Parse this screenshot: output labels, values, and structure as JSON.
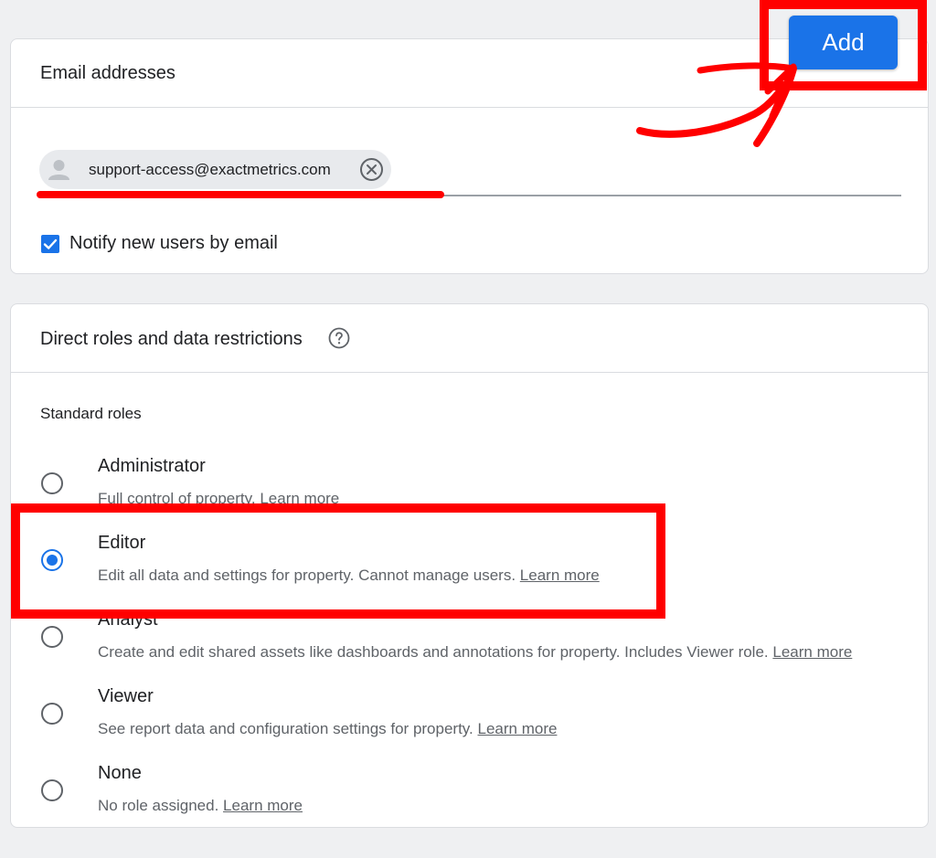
{
  "email_card": {
    "title": "Email addresses",
    "chip": {
      "email": "support-access@exactmetrics.com",
      "avatar_icon": "person-icon",
      "remove_icon": "close-circle-icon"
    },
    "notify": {
      "label": "Notify new users by email",
      "checked": true
    }
  },
  "add_button": {
    "label": "Add"
  },
  "roles_card": {
    "title": "Direct roles and data restrictions",
    "help_icon": "help-circle-icon",
    "section_label": "Standard roles",
    "roles": [
      {
        "name": "Administrator",
        "description": "Full control of property.",
        "link": "Learn more",
        "selected": false
      },
      {
        "name": "Editor",
        "description": "Edit all data and settings for property. Cannot manage users.",
        "link": "Learn more",
        "selected": true
      },
      {
        "name": "Analyst",
        "description": "Create and edit shared assets like dashboards and annotations for property. Includes Viewer role.",
        "link": "Learn more",
        "selected": false
      },
      {
        "name": "Viewer",
        "description": "See report data and configuration settings for property.",
        "link": "Learn more",
        "selected": false
      },
      {
        "name": "None",
        "description": "No role assigned.",
        "link": "Learn more",
        "selected": false
      }
    ]
  },
  "colors": {
    "accent": "#1a73e8",
    "annotation": "#ff0000",
    "background": "#eff0f2",
    "card": "#ffffff"
  }
}
